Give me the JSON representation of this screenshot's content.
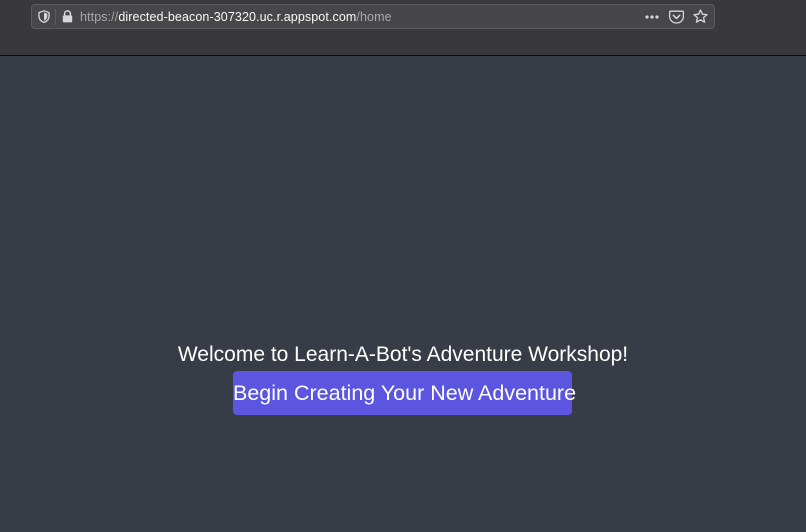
{
  "browser": {
    "url_scheme": "https://",
    "url_host": "directed-beacon-307320.uc.r.appspot.com",
    "url_path": "/home",
    "icons": [
      "tracking-protection-icon",
      "lock-icon",
      "more-actions-icon",
      "pocket-icon",
      "bookmark-star-icon"
    ]
  },
  "page": {
    "welcome_text": "Welcome to Learn-A-Bot's Adventure Workshop!",
    "cta_label": "Begin Creating Your New Adventure",
    "background_color": "#383c46",
    "accent_color": "#5b55e0"
  }
}
